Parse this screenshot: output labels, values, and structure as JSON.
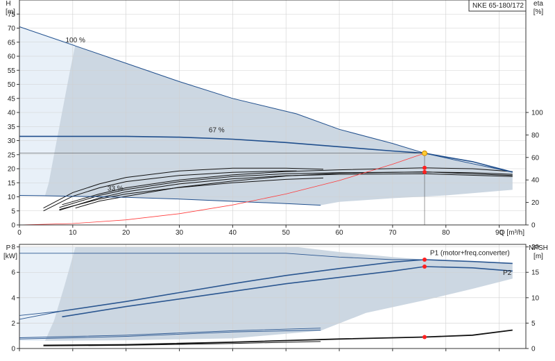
{
  "colors": {
    "envelope": "#ccd7e2",
    "envelope_light": "#e8f0f8",
    "curve_main": "#1f4e8c",
    "curve_thin": "#2a5690",
    "system_curve": "#ff3a3a",
    "duty_point_fill": "#ffcc33",
    "duty_point_stroke": "#cc8800",
    "marker": "#ff2020",
    "grid": "#d0d0d0",
    "text": "#222222"
  },
  "chart_data": [
    {
      "id": "head-efficiency",
      "type": "line",
      "title": "NKE 65-180/172",
      "xlabel": "Q [m³/h]",
      "ylabel_left": "H",
      "ylabel_left_unit": "[m]",
      "ylabel_right": "eta",
      "ylabel_right_unit": "[%]",
      "xlim": [
        0,
        95
      ],
      "ylim_left": [
        0,
        80
      ],
      "ylim_right": [
        0,
        200
      ],
      "x_ticks": [
        "0",
        "10",
        "20",
        "30",
        "40",
        "50",
        "60",
        "70",
        "80",
        "90"
      ],
      "y_ticks_left": [
        "0",
        "5",
        "10",
        "15",
        "20",
        "25",
        "30",
        "35",
        "40",
        "45",
        "50",
        "55",
        "60",
        "65",
        "70",
        "75"
      ],
      "y_ticks_right": [
        "0",
        "20",
        "40",
        "60",
        "80",
        "100"
      ],
      "grid": true,
      "speed_labels": [
        {
          "text": "100 %",
          "x": 10.5,
          "y": 65
        },
        {
          "text": "67 %",
          "x": 37,
          "y": 33
        },
        {
          "text": "33 %",
          "x": 18,
          "y": 12.2
        }
      ],
      "operating_envelope": [
        [
          0,
          70.5
        ],
        [
          10,
          64
        ],
        [
          20,
          57.5
        ],
        [
          30,
          51
        ],
        [
          40,
          45
        ],
        [
          52,
          39.5
        ],
        [
          60,
          34
        ],
        [
          70,
          29
        ],
        [
          76,
          25.5
        ],
        [
          82,
          23
        ],
        [
          92.5,
          18.8
        ],
        [
          92.5,
          12.5
        ],
        [
          80,
          10.5
        ],
        [
          70,
          9.5
        ],
        [
          60,
          8.2
        ],
        [
          56.5,
          7
        ],
        [
          20,
          10
        ],
        [
          4.5,
          10.3
        ],
        [
          0,
          10.5
        ]
      ],
      "low_flow_region": [
        [
          0,
          70.5
        ],
        [
          10.5,
          64.2
        ],
        [
          9.5,
          55
        ],
        [
          8.5,
          45
        ],
        [
          7.5,
          35
        ],
        [
          6.5,
          25
        ],
        [
          5.5,
          15
        ],
        [
          4.8,
          10.4
        ],
        [
          0,
          10.5
        ]
      ],
      "head_curves": [
        {
          "name": "100 %",
          "points": [
            [
              0,
              70.5
            ],
            [
              10,
              64
            ],
            [
              20,
              57.5
            ],
            [
              30,
              51
            ],
            [
              40,
              45
            ],
            [
              52,
              39.5
            ],
            [
              60,
              34
            ],
            [
              70,
              29
            ],
            [
              76,
              25.5
            ],
            [
              82,
              23
            ],
            [
              92.5,
              18.8
            ]
          ]
        },
        {
          "name": "67 %",
          "points": [
            [
              0,
              31.5
            ],
            [
              8,
              31.5
            ],
            [
              20,
              31.5
            ],
            [
              30,
              31.2
            ],
            [
              40,
              30.5
            ],
            [
              50,
              29.3
            ],
            [
              60,
              27.8
            ],
            [
              70,
              26.3
            ],
            [
              76,
              25.5
            ],
            [
              85,
              22.5
            ],
            [
              92.5,
              18.8
            ]
          ]
        },
        {
          "name": "33 %",
          "points": [
            [
              0,
              10.5
            ],
            [
              4.5,
              10.4
            ],
            [
              10,
              10.2
            ],
            [
              20,
              9.8
            ],
            [
              30,
              9.2
            ],
            [
              40,
              8.4
            ],
            [
              50,
              7.6
            ],
            [
              56.5,
              7
            ]
          ]
        }
      ],
      "efficiency_curves": [
        {
          "points": [
            [
              4.5,
              5
            ],
            [
              10,
              10.2
            ],
            [
              15,
              13.2
            ],
            [
              20,
              15.4
            ],
            [
              30,
              17.6
            ],
            [
              40,
              18.7
            ],
            [
              50,
              19.2
            ],
            [
              52,
              19.2
            ]
          ]
        },
        {
          "points": [
            [
              4.5,
              6
            ],
            [
              10,
              11.5
            ],
            [
              15,
              14.6
            ],
            [
              20,
              16.9
            ],
            [
              30,
              19.2
            ],
            [
              40,
              20.2
            ],
            [
              50,
              20.2
            ],
            [
              57,
              19.8
            ]
          ]
        },
        {
          "points": [
            [
              7.5,
              5.5
            ],
            [
              15,
              9.2
            ],
            [
              20,
              11
            ],
            [
              30,
              13.3
            ],
            [
              40,
              15
            ],
            [
              50,
              16.2
            ],
            [
              57,
              16.7
            ]
          ]
        },
        {
          "points": [
            [
              7.5,
              5.2
            ],
            [
              15,
              9.6
            ],
            [
              20,
              11.8
            ],
            [
              30,
              14.6
            ],
            [
              40,
              16.4
            ],
            [
              50,
              17.5
            ],
            [
              60,
              18
            ],
            [
              76,
              18.2
            ],
            [
              92.5,
              17.2
            ]
          ]
        },
        {
          "points": [
            [
              7.5,
              6.2
            ],
            [
              15,
              10.5
            ],
            [
              20,
              12.6
            ],
            [
              30,
              15.4
            ],
            [
              40,
              17.2
            ],
            [
              50,
              18.2
            ],
            [
              60,
              18.6
            ],
            [
              76,
              18.8
            ],
            [
              85,
              18.6
            ],
            [
              92.5,
              18
            ]
          ]
        },
        {
          "points": [
            [
              10.5,
              6
            ],
            [
              15,
              8.5
            ],
            [
              20,
              10.2
            ],
            [
              30,
              13.4
            ],
            [
              40,
              15.6
            ],
            [
              50,
              17.4
            ],
            [
              60,
              18.4
            ],
            [
              76,
              18.9
            ],
            [
              92.5,
              17.6
            ]
          ]
        },
        {
          "points": [
            [
              8,
              7.2
            ],
            [
              15,
              11
            ],
            [
              20,
              13.2
            ],
            [
              30,
              16
            ],
            [
              40,
              17.8
            ],
            [
              50,
              19
            ],
            [
              60,
              19.6
            ],
            [
              76,
              20.3
            ],
            [
              85,
              20
            ],
            [
              92.5,
              19
            ]
          ]
        }
      ],
      "system_curve": [
        [
          0,
          0
        ],
        [
          10,
          0.5
        ],
        [
          20,
          1.8
        ],
        [
          30,
          4
        ],
        [
          40,
          7.1
        ],
        [
          50,
          11
        ],
        [
          60,
          15.8
        ],
        [
          70,
          21.6
        ],
        [
          76,
          25.5
        ]
      ],
      "duty_point": {
        "x": 76,
        "y": 25.5
      },
      "markers": [
        {
          "x": 76,
          "y": 20.3
        },
        {
          "x": 76,
          "y": 18.8
        }
      ]
    },
    {
      "id": "power-npsh",
      "type": "line",
      "ylabel_left": "P",
      "ylabel_left_unit": "[kW]",
      "ylabel_right": "NPSH",
      "ylabel_right_unit": "[m]",
      "xlim": [
        0,
        95
      ],
      "ylim_left": [
        0,
        8.2
      ],
      "ylim_right": [
        0,
        20.5
      ],
      "x_ticks": [
        "0",
        "10",
        "20",
        "30",
        "40",
        "50",
        "60",
        "70",
        "80",
        "90"
      ],
      "y_ticks_left": [
        "0",
        "2",
        "4",
        "6",
        "8"
      ],
      "y_ticks_right": [
        "0",
        "5",
        "10",
        "15",
        "20"
      ],
      "grid": true,
      "series_labels": [
        {
          "text": "P1 (motor+freq.converter)",
          "x": 84.5,
          "y": 7.35
        },
        {
          "text": "P2",
          "x": 91.5,
          "y": 5.8
        }
      ],
      "operating_envelope": [
        [
          0,
          8
        ],
        [
          10.5,
          8
        ],
        [
          20,
          8
        ],
        [
          40,
          8
        ],
        [
          52,
          8
        ],
        [
          60,
          7.6
        ],
        [
          70,
          7.2
        ],
        [
          76,
          7
        ],
        [
          85,
          6.8
        ],
        [
          92.5,
          6.7
        ],
        [
          92.5,
          5.5
        ],
        [
          85,
          4.7
        ],
        [
          76,
          3.8
        ],
        [
          65,
          2.8
        ],
        [
          56.5,
          1.4
        ],
        [
          40,
          0.8
        ],
        [
          20,
          0.65
        ],
        [
          4.5,
          0.6
        ],
        [
          0,
          0.6
        ]
      ],
      "low_flow_region": [
        [
          0,
          8
        ],
        [
          10.5,
          8
        ],
        [
          8.5,
          5
        ],
        [
          6.5,
          2.2
        ],
        [
          4.8,
          0.6
        ],
        [
          0,
          0.6
        ]
      ],
      "power_curves": [
        {
          "name": "P1 (motor+freq.converter)",
          "points": [
            [
              8,
              2.95
            ],
            [
              20,
              3.7
            ],
            [
              30,
              4.4
            ],
            [
              40,
              5.1
            ],
            [
              50,
              5.75
            ],
            [
              60,
              6.3
            ],
            [
              70,
              6.8
            ],
            [
              76,
              7
            ],
            [
              85,
              6.85
            ],
            [
              92.5,
              6.7
            ]
          ]
        },
        {
          "name": "P2",
          "points": [
            [
              8,
              2.5
            ],
            [
              20,
              3.3
            ],
            [
              30,
              3.9
            ],
            [
              40,
              4.5
            ],
            [
              50,
              5.1
            ],
            [
              60,
              5.6
            ],
            [
              70,
              6.1
            ],
            [
              76,
              6.45
            ],
            [
              85,
              6.35
            ],
            [
              92.5,
              6.1
            ]
          ]
        },
        {
          "points": [
            [
              0,
              2.3
            ],
            [
              8,
              2.95
            ]
          ]
        },
        {
          "points": [
            [
              0,
              2.6
            ],
            [
              8,
              2.95
            ]
          ]
        },
        {
          "points": [
            [
              0,
              7.5
            ],
            [
              20,
              7.5
            ],
            [
              50,
              7.5
            ],
            [
              60,
              7.2
            ],
            [
              70,
              7.0
            ],
            [
              76,
              7.0
            ]
          ]
        },
        {
          "points": [
            [
              0,
              0.85
            ],
            [
              10,
              0.95
            ],
            [
              20,
              1.05
            ],
            [
              40,
              1.4
            ],
            [
              56.5,
              1.6
            ]
          ]
        },
        {
          "points": [
            [
              0,
              0.75
            ],
            [
              10,
              0.85
            ],
            [
              20,
              0.95
            ],
            [
              40,
              1.3
            ],
            [
              56.5,
              1.45
            ]
          ]
        }
      ],
      "npsh_curves": [
        {
          "points": [
            [
              4.5,
              0.25
            ],
            [
              20,
              0.3
            ],
            [
              40,
              0.5
            ],
            [
              60,
              0.75
            ],
            [
              76,
              0.9
            ],
            [
              85,
              1.05
            ],
            [
              92.5,
              1.45
            ]
          ]
        },
        {
          "points": [
            [
              4.5,
              0.2
            ],
            [
              20,
              0.25
            ],
            [
              40,
              0.4
            ],
            [
              56.5,
              0.55
            ]
          ]
        }
      ],
      "markers": [
        {
          "x": 76,
          "y": 7.0
        },
        {
          "x": 76,
          "y": 6.45
        },
        {
          "x": 76,
          "y": 0.9
        }
      ]
    }
  ]
}
